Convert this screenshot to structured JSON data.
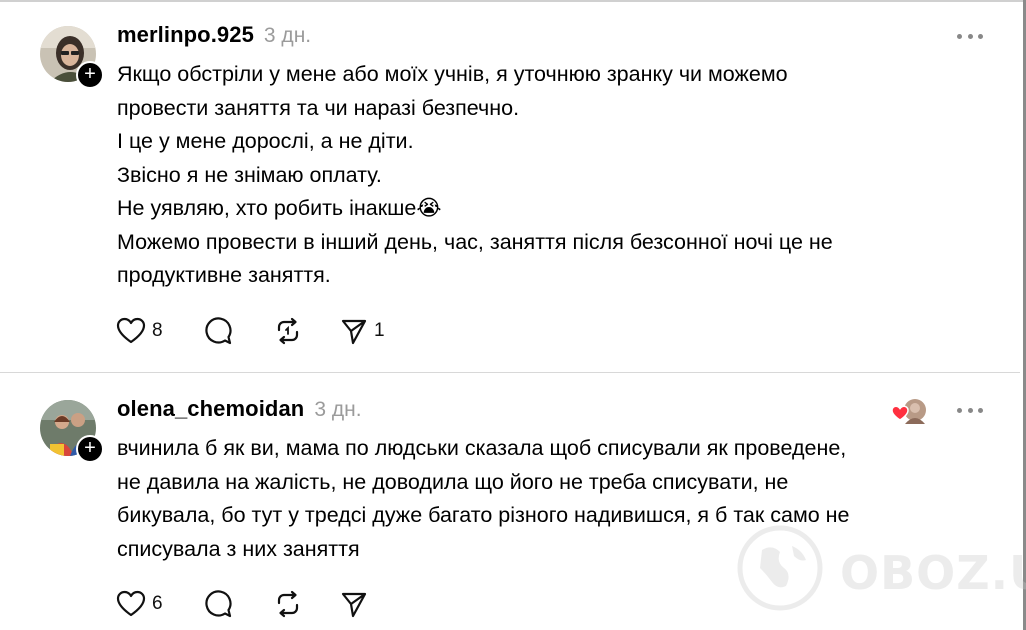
{
  "posts": [
    {
      "username": "merlinpo.925",
      "time": "3 дн.",
      "text_lines": [
        "Якщо обстріли у мене або моїх учнів, я уточнюю зранку чи можемо",
        "провести заняття та чи наразі безпечно.",
        "І це у мене дорослі, а не діти.",
        "Звісно я не знімаю оплату.",
        "Не уявляю, хто робить інакше😭",
        "Можемо провести в інший день, час, заняття після безсонної ночі це не",
        "продуктивне заняття."
      ],
      "likes": "8",
      "shares": "1",
      "icons": [
        "heart-icon",
        "comment-icon",
        "repost-icon",
        "send-icon",
        "more-icon"
      ]
    },
    {
      "username": "olena_chemoidan",
      "time": "3 дн.",
      "text_lines": [
        "вчинила б як ви, мама по людськи сказала щоб списували як проведене,",
        "не давила на жалість, не доводила що його не треба списувати, не",
        "бикувала, бо тут у тредсі дуже багато різного надивишся, я б так само не",
        "списувала з них заняття"
      ],
      "likes": "6",
      "icons": [
        "heart-icon",
        "comment-icon",
        "repost-icon",
        "send-icon",
        "more-icon"
      ]
    }
  ],
  "follow_symbol": "+",
  "watermark": "OBOZ.UA",
  "colors": {
    "muted": "#9b9b9b",
    "heart_red": "#ff3040",
    "divider": "#d8d8d8"
  }
}
